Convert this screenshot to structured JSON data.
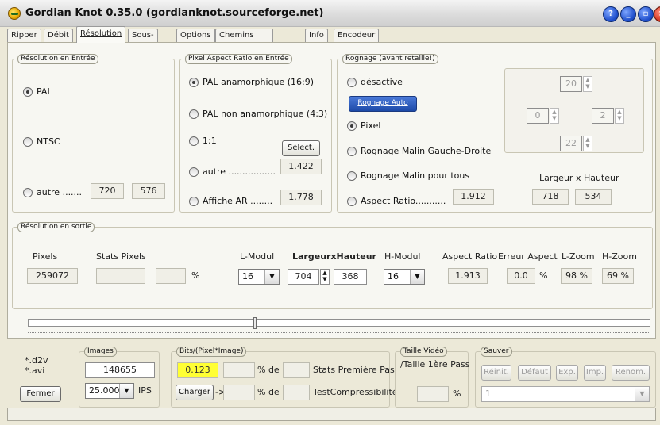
{
  "window": {
    "title": "Gordian Knot 0.35.0  (gordianknot.sourceforge.net)"
  },
  "tabs": [
    "Ripper",
    "Débit",
    "Résolution",
    "Sous-Titres",
    "Options",
    "Chemins Programmes",
    "Info",
    "Encodeur"
  ],
  "active_tab": "Résolution",
  "res_in": {
    "label": "Résolution en Entrée",
    "pal": "PAL",
    "ntsc": "NTSC",
    "other": "autre .......",
    "w": "720",
    "h": "576",
    "selected": "PAL"
  },
  "par": {
    "label": "Pixel Aspect Ratio en Entrée",
    "opt1": "PAL anamorphique (16:9)",
    "opt2": "PAL non anamorphique (4:3)",
    "opt3": "1:1",
    "opt4": "autre .................",
    "opt5": "Affiche AR ........",
    "select_btn": "Sélect.",
    "other_val": "1.422",
    "ar_val": "1.778",
    "selected": "PAL anamorphique (16:9)"
  },
  "crop": {
    "label": "Rognage (avant retaille!)",
    "opt1": "désactive",
    "auto_btn": "Rognage Auto",
    "opt2": "Pixel",
    "opt3": "Rognage Malin Gauche-Droite",
    "opt4": "Rognage Malin pour tous",
    "opt5": "Aspect Ratio...........",
    "ar_val": "1.912",
    "top": "20",
    "left": "0",
    "right": "2",
    "bottom": "22",
    "wh_label": "Largeur x Hauteur",
    "w": "718",
    "h": "534",
    "selected": "Pixel"
  },
  "res_out": {
    "label": "Résolution en sortie",
    "pixels_label": "Pixels",
    "stats_label": "Stats Pixels",
    "lmodul_label": "L-Modul",
    "wh_label": "LargeurxHauteur",
    "hmodul_label": "H-Modul",
    "ar_label": "Aspect Ratio",
    "err_label": "Erreur Aspect",
    "lzoom_label": "L-Zoom",
    "hzoom_label": "H-Zoom",
    "pixels": "259072",
    "pct": "%",
    "lmodul": "16",
    "width": "704",
    "height": "368",
    "hmodul": "16",
    "ar": "1.913",
    "err": "0.0",
    "err_pct": "%",
    "lzoom": "98 %",
    "hzoom": "69 %"
  },
  "bottom": {
    "files": "*.d2v\n*.avi",
    "close_btn": "Fermer",
    "images_label": "Images",
    "images": "148655",
    "fps": "25.000",
    "fps_unit": "IPS",
    "bpp_label": "Bits/(Pixel*Image)",
    "bpp": "0.123",
    "pct_de": "% de",
    "stats_first": "Stats Première Pass",
    "charger_btn": "Charger",
    "arrow": "->",
    "pct_de2": "% de",
    "test": "TestCompressibilité",
    "video_label": "Taille Vidéo",
    "video_sub": "/Taille 1ère Pass",
    "video_pct": "%",
    "save_label": "Sauver",
    "reinit": "Réinit.",
    "defaut": "Défaut",
    "exp": "Exp.",
    "imp": "Imp.",
    "renom": "Renom.",
    "preset": "1"
  },
  "colors": {
    "highlight": "#ffff33",
    "accent": "#1d4aa8"
  }
}
